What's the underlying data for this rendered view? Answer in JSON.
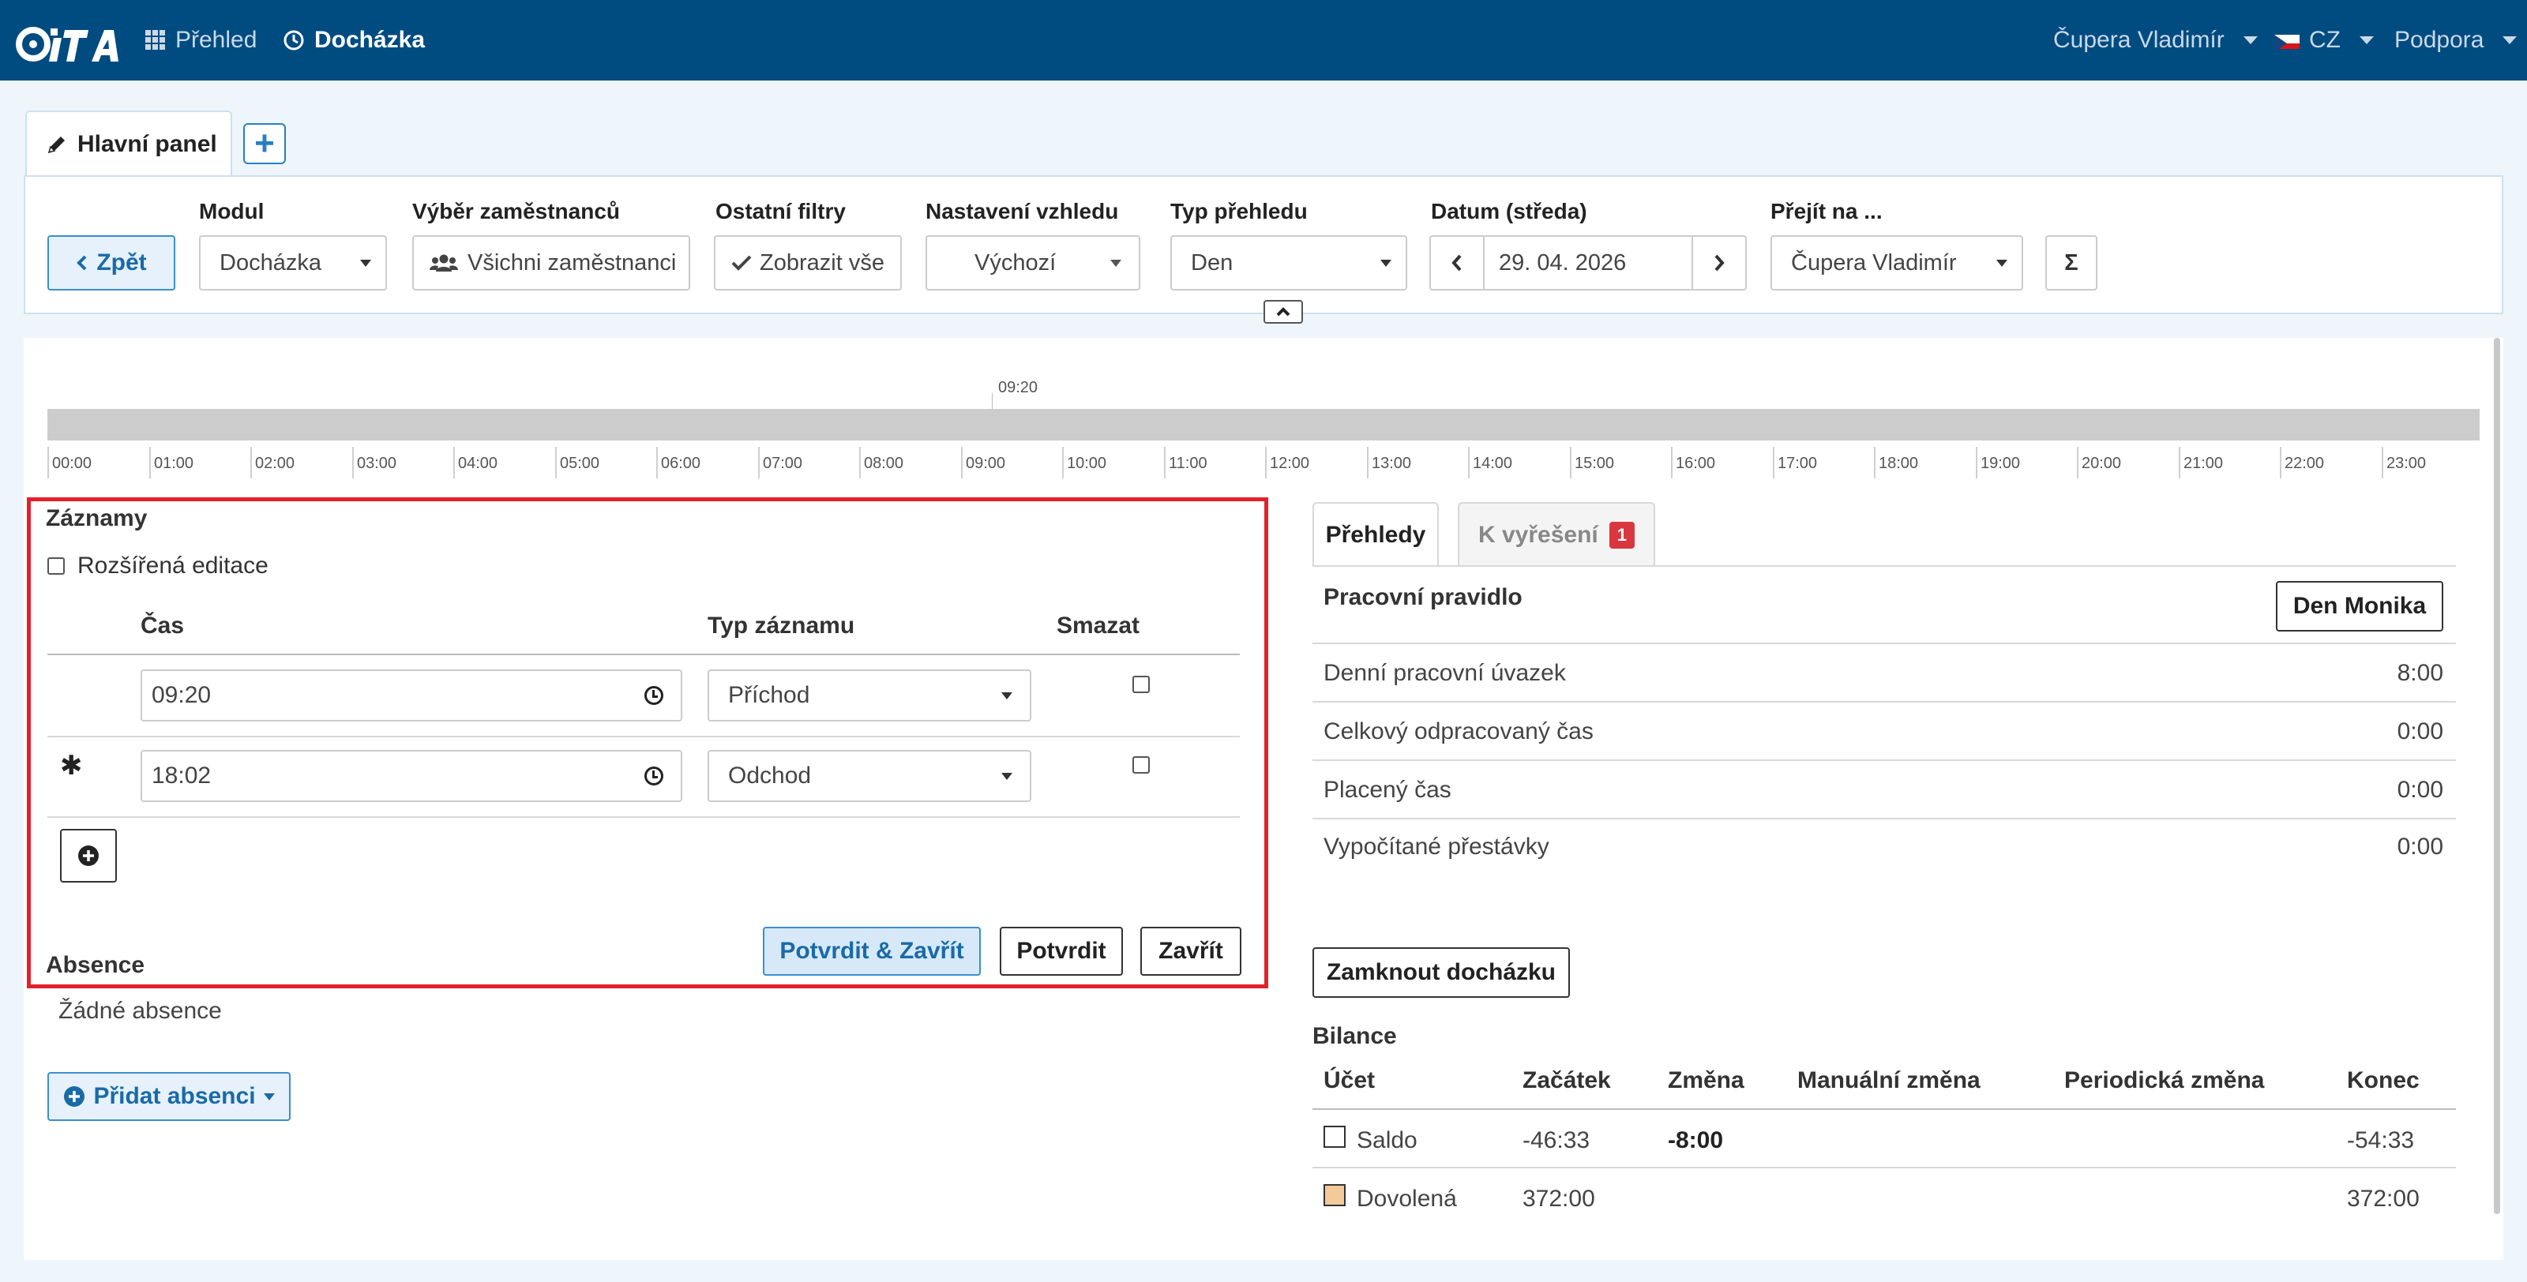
{
  "navbar": {
    "logo_text": "ciTA",
    "items": [
      {
        "label": "Přehled",
        "icon": "grid-icon"
      },
      {
        "label": "Docházka",
        "icon": "clock-icon"
      }
    ],
    "user": "Čupera Vladimír",
    "language": "CZ",
    "support": "Podpora",
    "bg_color": "#004b80"
  },
  "tabs": {
    "main": "Hlavní panel",
    "add": "+"
  },
  "filters": {
    "back_label": "Zpět",
    "modul": {
      "label": "Modul",
      "value": "Docházka"
    },
    "employees": {
      "label": "Výběr zaměstnanců",
      "value": "Všichni zaměstnanci"
    },
    "other": {
      "label": "Ostatní filtry",
      "value": "Zobrazit vše"
    },
    "appearance": {
      "label": "Nastavení vzhledu",
      "value": "Výchozí"
    },
    "overview_type": {
      "label": "Typ přehledu",
      "value": "Den"
    },
    "date": {
      "label": "Datum (středa)",
      "value": "29. 04. 2026"
    },
    "goto": {
      "label": "Přejít na ...",
      "value": "Čupera Vladimír"
    },
    "sum_label": "Σ"
  },
  "timeline": {
    "marker": "09:20",
    "hours": [
      "00:00",
      "01:00",
      "02:00",
      "03:00",
      "04:00",
      "05:00",
      "06:00",
      "07:00",
      "08:00",
      "09:00",
      "10:00",
      "11:00",
      "12:00",
      "13:00",
      "14:00",
      "15:00",
      "16:00",
      "17:00",
      "18:00",
      "19:00",
      "20:00",
      "21:00",
      "22:00",
      "23:00"
    ]
  },
  "records": {
    "title": "Záznamy",
    "extended_edit": "Rozšířená editace",
    "col_time": "Čas",
    "col_type": "Typ záznamu",
    "col_delete": "Smazat",
    "rows": [
      {
        "marker": "",
        "time": "09:20",
        "type": "Příchod"
      },
      {
        "marker": "✱",
        "time": "18:02",
        "type": "Odchod"
      }
    ],
    "btn_confirm_close": "Potvrdit & Zavřít",
    "btn_confirm": "Potvrdit",
    "btn_close": "Zavřít"
  },
  "absence": {
    "title": "Absence",
    "empty": "Žádné absence",
    "add_label": "Přidat absenci"
  },
  "overview": {
    "tab_overview": "Přehledy",
    "tab_resolve": "K vyřešení",
    "resolve_count": "1",
    "work_rule_label": "Pracovní pravidlo",
    "work_rule_value": "Den Monika",
    "rows": [
      {
        "label": "Denní pracovní úvazek",
        "value": "8:00"
      },
      {
        "label": "Celkový odpracovaný čas",
        "value": "0:00"
      },
      {
        "label": "Placený čas",
        "value": "0:00"
      },
      {
        "label": "Vypočítané přestávky",
        "value": "0:00"
      }
    ],
    "lock_label": "Zamknout docházku"
  },
  "balance": {
    "title": "Bilance",
    "headers": [
      "Účet",
      "Začátek",
      "Změna",
      "Manuální změna",
      "Periodická změna",
      "Konec"
    ],
    "rows": [
      {
        "account": "Saldo",
        "color": "#ffffff",
        "start": "-46:33",
        "change": "-8:00",
        "manual": "",
        "periodic": "",
        "end": "-54:33"
      },
      {
        "account": "Dovolená",
        "color": "#f6c99a",
        "start": "372:00",
        "change": "",
        "manual": "",
        "periodic": "",
        "end": "372:00"
      }
    ]
  }
}
